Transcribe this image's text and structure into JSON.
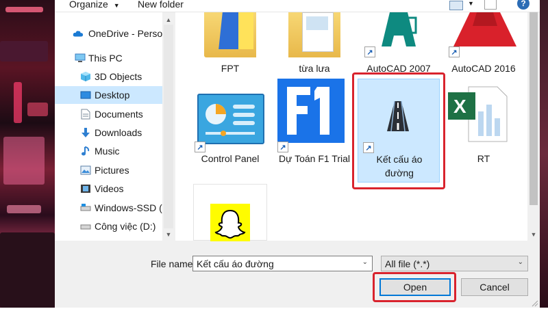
{
  "toolbar": {
    "organize_label": "Organize",
    "new_folder_label": "New folder"
  },
  "nav": {
    "items": [
      {
        "label": "OneDrive - Person",
        "icon": "cloud-icon"
      },
      {
        "label": "This PC",
        "icon": "computer-icon"
      },
      {
        "label": "3D Objects",
        "icon": "cube-icon"
      },
      {
        "label": "Desktop",
        "icon": "desktop-icon",
        "selected": true
      },
      {
        "label": "Documents",
        "icon": "document-icon"
      },
      {
        "label": "Downloads",
        "icon": "download-arrow-icon"
      },
      {
        "label": "Music",
        "icon": "music-note-icon"
      },
      {
        "label": "Pictures",
        "icon": "picture-icon"
      },
      {
        "label": "Videos",
        "icon": "film-icon"
      },
      {
        "label": "Windows-SSD (C",
        "icon": "drive-icon"
      },
      {
        "label": "Công việc (D:)",
        "icon": "drive-icon"
      }
    ]
  },
  "files": [
    {
      "label": "FPT",
      "icon": "folder-icon"
    },
    {
      "label": "từa lưa",
      "icon": "folder-icon"
    },
    {
      "label": "AutoCAD 2007",
      "icon": "autocad-icon"
    },
    {
      "label": "AutoCAD 2016",
      "icon": "autocad-icon"
    },
    {
      "label": "Control Panel",
      "icon": "control-panel-icon"
    },
    {
      "label": "Dự Toán F1 Trial",
      "icon": "f1-app-icon"
    },
    {
      "label_line1": "Kết cấu áo",
      "label_line2": "đường",
      "icon": "road-icon",
      "selected": true
    },
    {
      "label": "RT",
      "icon": "excel-icon"
    },
    {
      "label": "",
      "icon": "snapchat-icon"
    }
  ],
  "filename": {
    "label": "File name:",
    "value": "Kết cấu áo đường"
  },
  "filetype": {
    "value": "All file (*.*)"
  },
  "buttons": {
    "open": "Open",
    "cancel": "Cancel"
  },
  "colors": {
    "selection": "#cce8ff",
    "highlight_box": "#d9232d",
    "accent": "#0078d7"
  }
}
